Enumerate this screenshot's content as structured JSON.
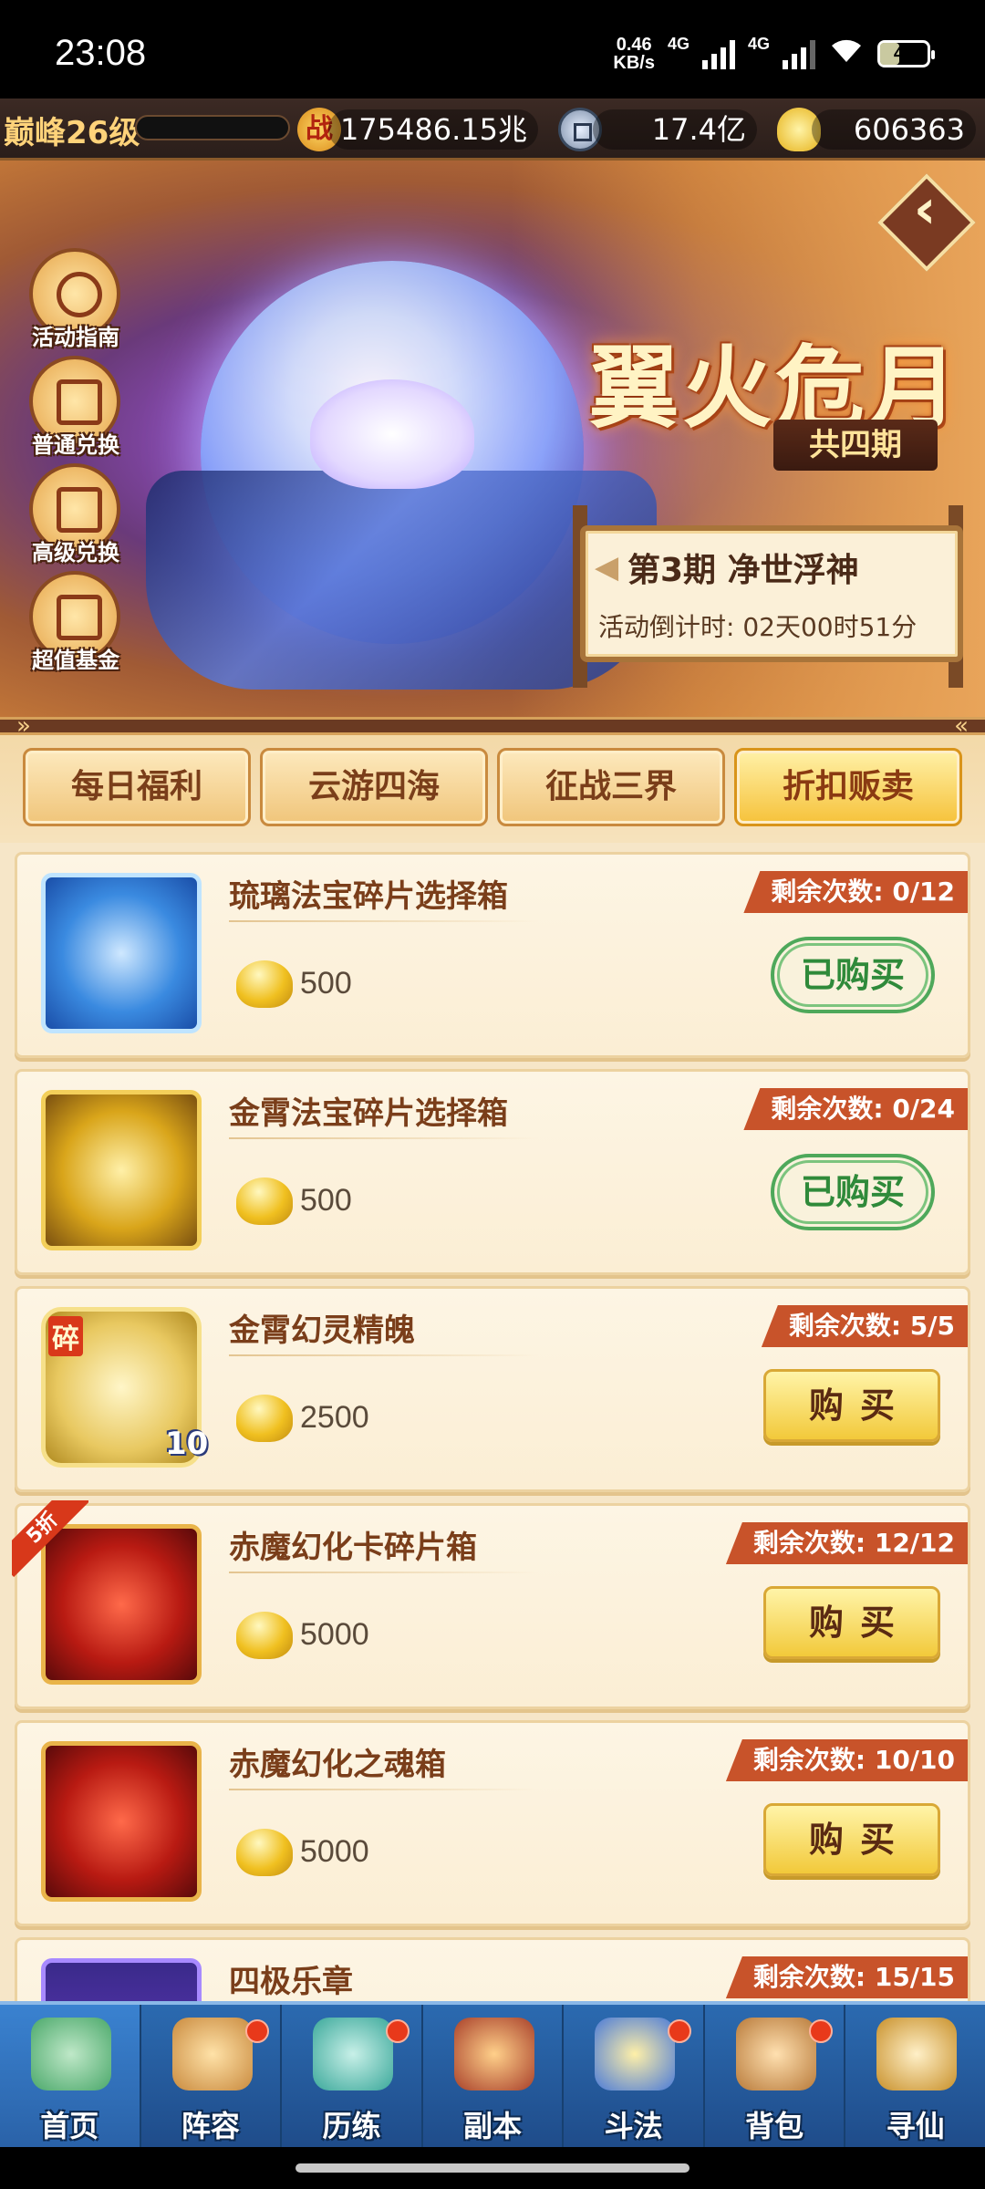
{
  "status_bar": {
    "time": "23:08",
    "speed_value": "0.46",
    "speed_unit": "KB/s",
    "net1": "4G",
    "net2": "4G",
    "battery": "41"
  },
  "resources": {
    "level": "巅峰26级",
    "battle_power_icon": "战",
    "battle_power": "175486.15兆",
    "coins": "17.4亿",
    "ingots": "606363"
  },
  "banner": {
    "event_title": "翼火危月",
    "event_sub": "共四期",
    "period_title": "第3期  净世浮神",
    "countdown": "活动倒计时: 02天00时51分"
  },
  "side_menu": [
    {
      "label": "活动指南",
      "icon": "magnifier-icon"
    },
    {
      "label": "普通兑换",
      "icon": "gift-box-icon"
    },
    {
      "label": "高级兑换",
      "icon": "gift-icon"
    },
    {
      "label": "超值基金",
      "icon": "fund-icon"
    }
  ],
  "tabs": [
    {
      "label": "每日福利",
      "active": false
    },
    {
      "label": "云游四海",
      "active": false
    },
    {
      "label": "征战三界",
      "active": false
    },
    {
      "label": "折扣贩卖",
      "active": true
    }
  ],
  "items": [
    {
      "name": "琉璃法宝碎片选择箱",
      "price": "500",
      "remaining": "剩余次数: 0/12",
      "button": "已购买",
      "bought": true,
      "icon": "glass-chest-icon"
    },
    {
      "name": "金霄法宝碎片选择箱",
      "price": "500",
      "remaining": "剩余次数: 0/24",
      "button": "已购买",
      "bought": true,
      "icon": "gold-chest-icon"
    },
    {
      "name": "金霄幻灵精魄",
      "price": "2500",
      "remaining": "剩余次数: 5/5",
      "button": "购买",
      "bought": false,
      "icon": "golden-beast-icon",
      "fragment_tag": "碎",
      "count": "10"
    },
    {
      "name": "赤魔幻化卡碎片箱",
      "price": "5000",
      "remaining": "剩余次数: 12/12",
      "button": "购买",
      "bought": false,
      "icon": "red-chest-icon",
      "discount": "5折"
    },
    {
      "name": "赤魔幻化之魂箱",
      "price": "5000",
      "remaining": "剩余次数: 10/10",
      "button": "购买",
      "bought": false,
      "icon": "flame-chest-icon"
    },
    {
      "name": "四极乐章",
      "remaining": "剩余次数: 15/15",
      "icon": "purple-item-icon"
    }
  ],
  "bottom_nav": [
    {
      "label": "首页",
      "dot": false,
      "active": true
    },
    {
      "label": "阵容",
      "dot": true,
      "active": false
    },
    {
      "label": "历练",
      "dot": true,
      "active": false
    },
    {
      "label": "副本",
      "dot": false,
      "active": false
    },
    {
      "label": "斗法",
      "dot": true,
      "active": false
    },
    {
      "label": "背包",
      "dot": true,
      "active": false
    },
    {
      "label": "寻仙",
      "dot": false,
      "active": false
    }
  ],
  "colors": {
    "accent_orange": "#c8532a",
    "bought_green": "#2f8a3a",
    "buy_gold": "#f2c93a",
    "nav_blue": "#2b6ab0"
  }
}
